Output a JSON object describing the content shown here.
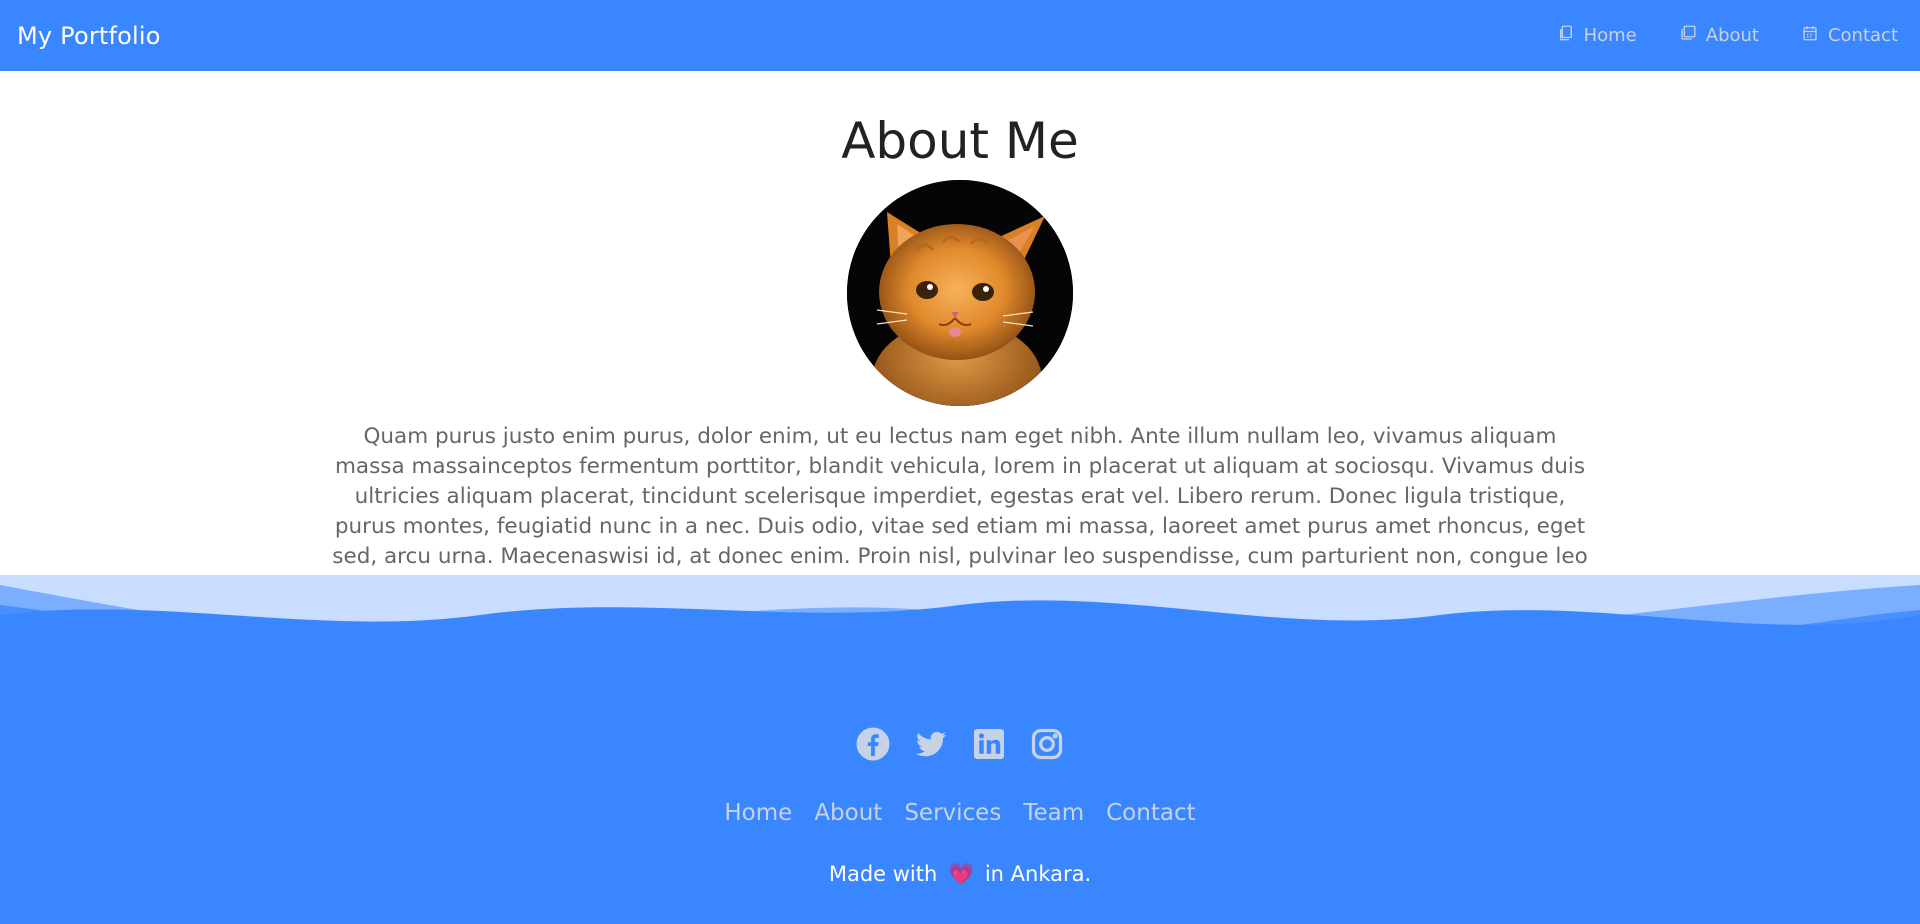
{
  "theme": {
    "accent": "#3a86ff",
    "muted_link": "#c6d3e6",
    "heart": "#e8396b"
  },
  "navbar": {
    "brand": "My Portfolio",
    "links": [
      {
        "label": "Home",
        "icon": "copy-pages-icon"
      },
      {
        "label": "About",
        "icon": "stacked-squares-icon"
      },
      {
        "label": "Contact",
        "icon": "calendar-icon"
      }
    ]
  },
  "main": {
    "title": "About Me",
    "avatar": "kitten-photo",
    "bio": "Quam purus justo enim purus, dolor enim, ut eu lectus nam eget nibh. Ante illum nullam leo, vivamus aliquam massa massainceptos fermentum porttitor, blandit vehicula, lorem in placerat ut aliquam at sociosqu. Vivamus duis ultricies aliquam placerat, tincidunt scelerisque imperdiet, egestas erat vel. Libero rerum. Donec ligula tristique, purus montes, feugiatid nunc in a nec. Duis odio, vitae sed etiam mi massa, laoreet amet purus amet rhoncus, eget sed, arcu urna. Maecenaswisi id, at donec enim. Proin nisl, pulvinar leo suspendisse, cum parturient non, congue leo et ut in, neque ut lacusauctor quam fermentum urna. Metus quis, mauris dictum aptent ultrices nulla elit enim leo donec,sed sed. Vivamus sapien facilisi, tempor arcu nulla lectus. Metusgravida."
  },
  "footer": {
    "social": [
      "facebook-icon",
      "twitter-icon",
      "linkedin-icon",
      "instagram-icon"
    ],
    "menu": [
      "Home",
      "About",
      "Services",
      "Team",
      "Contact"
    ],
    "made_with_prefix": "Made with",
    "heart": "💗",
    "made_with_suffix": "in Ankara."
  }
}
